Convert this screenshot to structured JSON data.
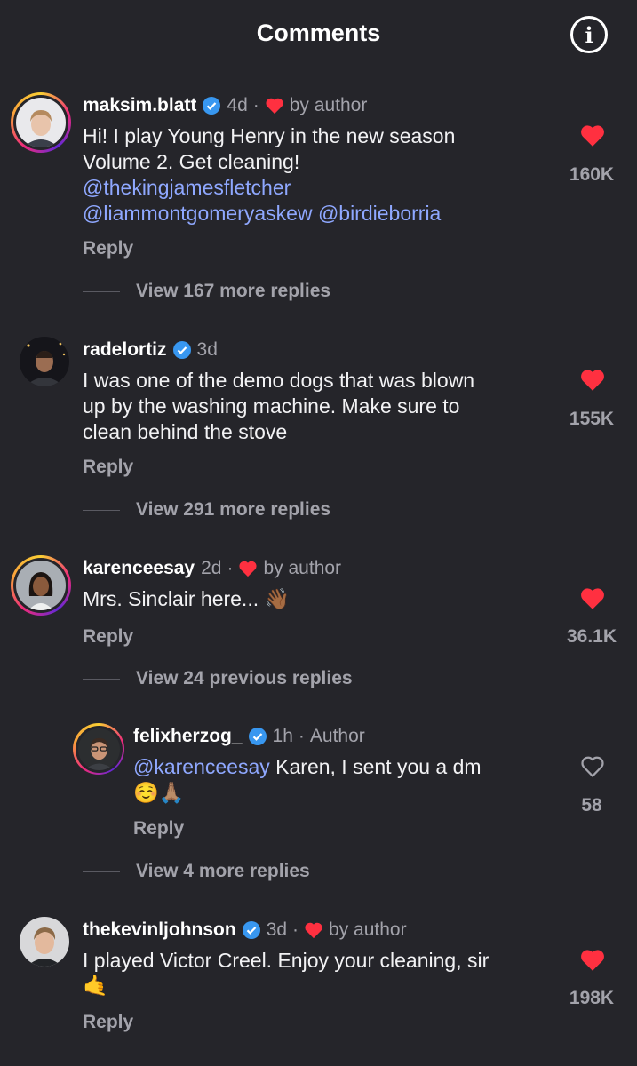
{
  "header": {
    "title": "Comments",
    "info_icon": "info-icon",
    "info_glyph": "i"
  },
  "colors": {
    "background": "#25252a",
    "like_red": "#ff3040",
    "mention": "#8fa8ff",
    "verified": "#3897f0"
  },
  "comments": [
    {
      "username": "maksim.blatt",
      "verified": true,
      "time": "4d",
      "liked_by_author": true,
      "by_author_label": "by author",
      "text_lines": [
        "Hi! I play Young Henry in the new season",
        "Volume 2. Get cleaning!"
      ],
      "mentions": [
        "@thekingjamesfletcher",
        "@liammontgomeryaskew",
        "@birdieborria"
      ],
      "reply_label": "Reply",
      "view_replies": "View 167 more replies",
      "likes": "160K",
      "liked": true
    },
    {
      "username": "radelortiz",
      "verified": true,
      "time": "3d",
      "text_lines": [
        "I was one of the demo dogs that was blown",
        "up by the washing machine. Make sure to",
        "clean behind the stove"
      ],
      "reply_label": "Reply",
      "view_replies": "View 291 more replies",
      "likes": "155K",
      "liked": true
    },
    {
      "username": "karenceesay",
      "time": "2d",
      "liked_by_author": true,
      "by_author_label": "by author",
      "text": "Mrs. Sinclair here... ",
      "emoji": "👋🏾",
      "reply_label": "Reply",
      "view_replies": "View 24 previous replies",
      "likes": "36.1K",
      "liked": true
    },
    {
      "username": "felixherzog_",
      "verified": true,
      "time": "1h",
      "author_label": "Author",
      "mention": "@karenceesay",
      "text": " Karen, I sent you a dm",
      "emoji": "☺️🙏🏽",
      "reply_label": "Reply",
      "view_replies": "View 4 more replies",
      "likes": "58",
      "liked": false
    },
    {
      "username": "thekevinljohnson",
      "verified": true,
      "time": "3d",
      "liked_by_author": true,
      "by_author_label": "by author",
      "text": "I played Victor Creel. Enjoy your cleaning, sir",
      "emoji": "🤙",
      "reply_label": "Reply",
      "likes": "198K",
      "liked": true
    }
  ]
}
